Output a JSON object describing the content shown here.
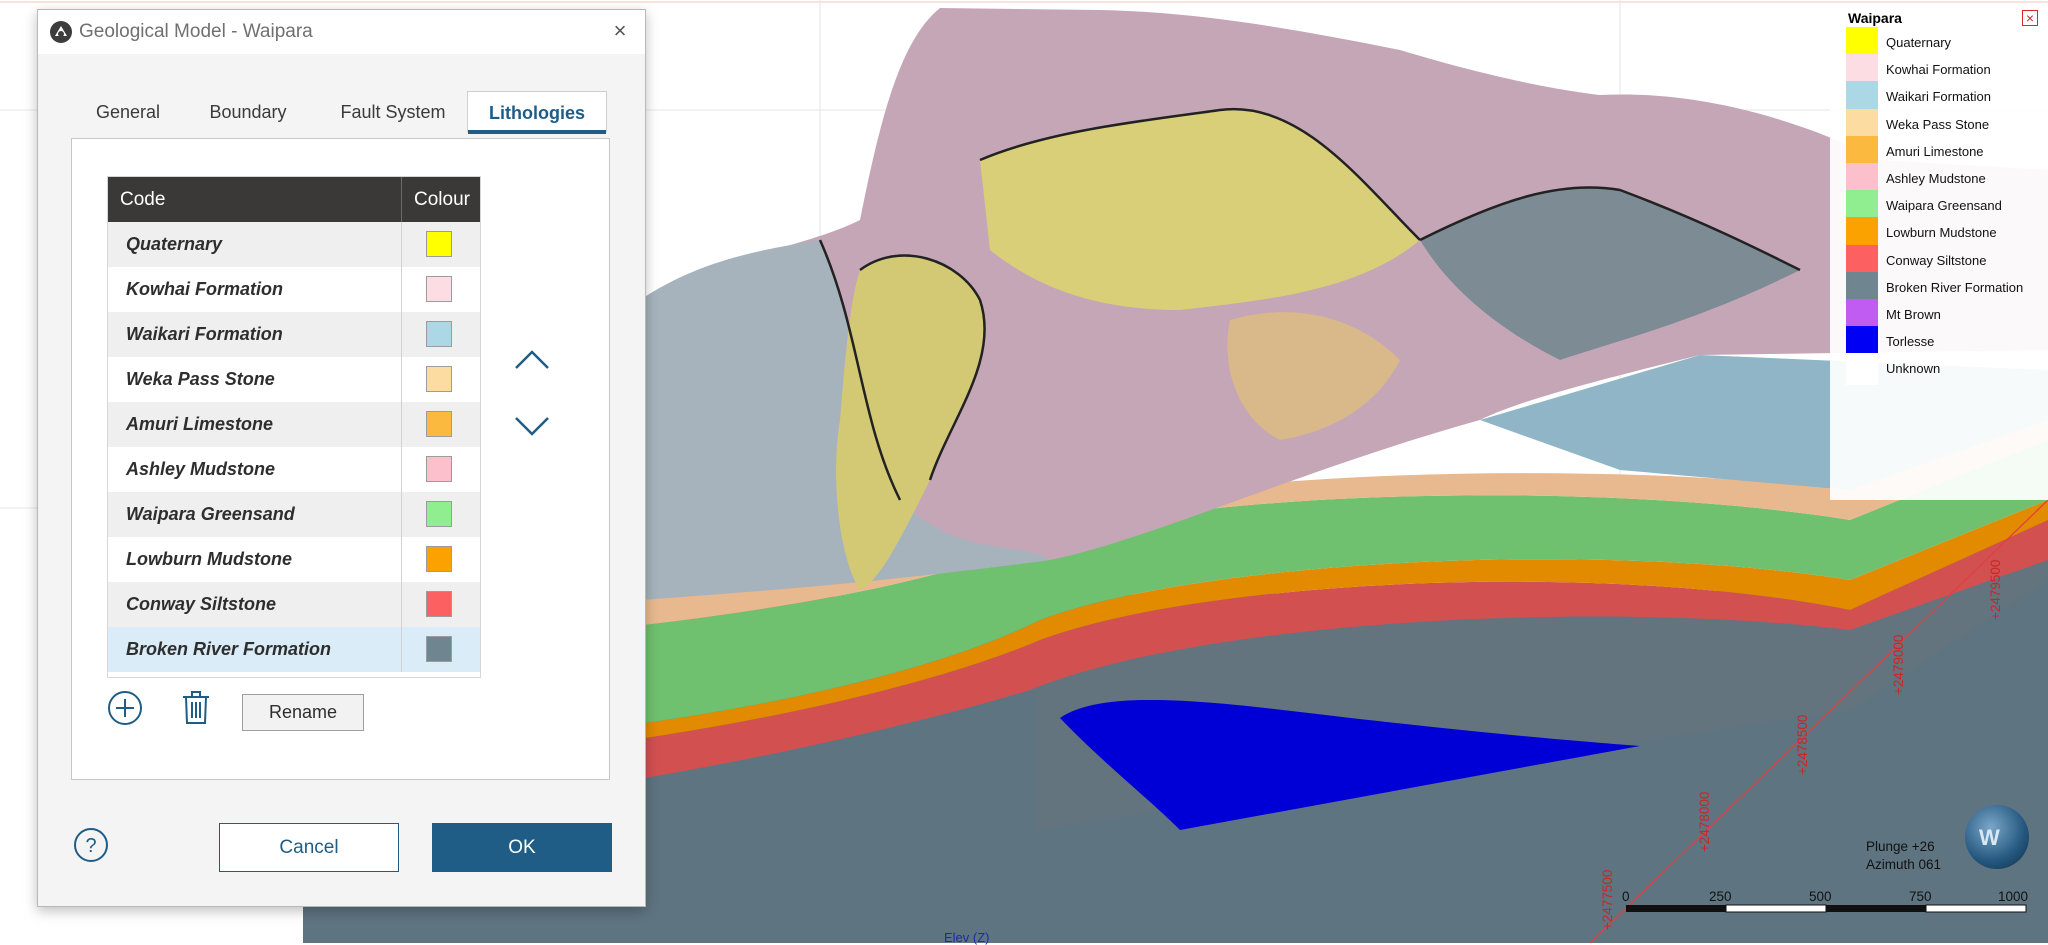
{
  "dialog": {
    "title": "Geological Model - Waipara",
    "tabs": [
      "General",
      "Boundary",
      "Fault System",
      "Lithologies"
    ],
    "active_tab": "Lithologies",
    "table": {
      "headers": {
        "code": "Code",
        "colour": "Colour"
      },
      "rows": [
        {
          "code": "Quaternary",
          "colour": "#ffff00"
        },
        {
          "code": "Kowhai Formation",
          "colour": "#fcdde4"
        },
        {
          "code": "Waikari Formation",
          "colour": "#acd8e6"
        },
        {
          "code": "Weka Pass Stone",
          "colour": "#fcdca0"
        },
        {
          "code": "Amuri Limestone",
          "colour": "#fcb940"
        },
        {
          "code": "Ashley Mudstone",
          "colour": "#fbc0cb"
        },
        {
          "code": "Waipara Greensand",
          "colour": "#90ee90"
        },
        {
          "code": "Lowburn Mudstone",
          "colour": "#fba100"
        },
        {
          "code": "Conway Siltstone",
          "colour": "#fd6060"
        },
        {
          "code": "Broken River Formation",
          "colour": "#6f8690"
        }
      ],
      "selected_row": 9
    },
    "rename_label": "Rename",
    "cancel_label": "Cancel",
    "ok_label": "OK"
  },
  "legend": {
    "title": "Waipara",
    "items": [
      {
        "label": "Quaternary",
        "color": "#ffff00"
      },
      {
        "label": "Kowhai Formation",
        "color": "#fcdde4"
      },
      {
        "label": "Waikari Formation",
        "color": "#acd8e6"
      },
      {
        "label": "Weka Pass Stone",
        "color": "#fcdca0"
      },
      {
        "label": "Amuri Limestone",
        "color": "#fcb940"
      },
      {
        "label": "Ashley Mudstone",
        "color": "#fbc0cb"
      },
      {
        "label": "Waipara Greensand",
        "color": "#90ee90"
      },
      {
        "label": "Lowburn Mudstone",
        "color": "#fba100"
      },
      {
        "label": "Conway Siltstone",
        "color": "#fd6060"
      },
      {
        "label": "Broken River Formation",
        "color": "#6f8690"
      },
      {
        "label": "Mt Brown",
        "color": "#c15cf2"
      },
      {
        "label": "Torlesse",
        "color": "#0000f5"
      },
      {
        "label": "Unknown",
        "color": "#ffffff"
      }
    ]
  },
  "view": {
    "plunge": "Plunge +26",
    "azimuth": "Azimuth 061",
    "scale_labels": [
      "0",
      "250",
      "500",
      "750",
      "1000"
    ],
    "axis_label": "Elev (Z)",
    "coordinates": [
      "+2477500",
      "+2478000",
      "+2478500",
      "+2479000",
      "+2479500"
    ],
    "globe_text": "W"
  }
}
